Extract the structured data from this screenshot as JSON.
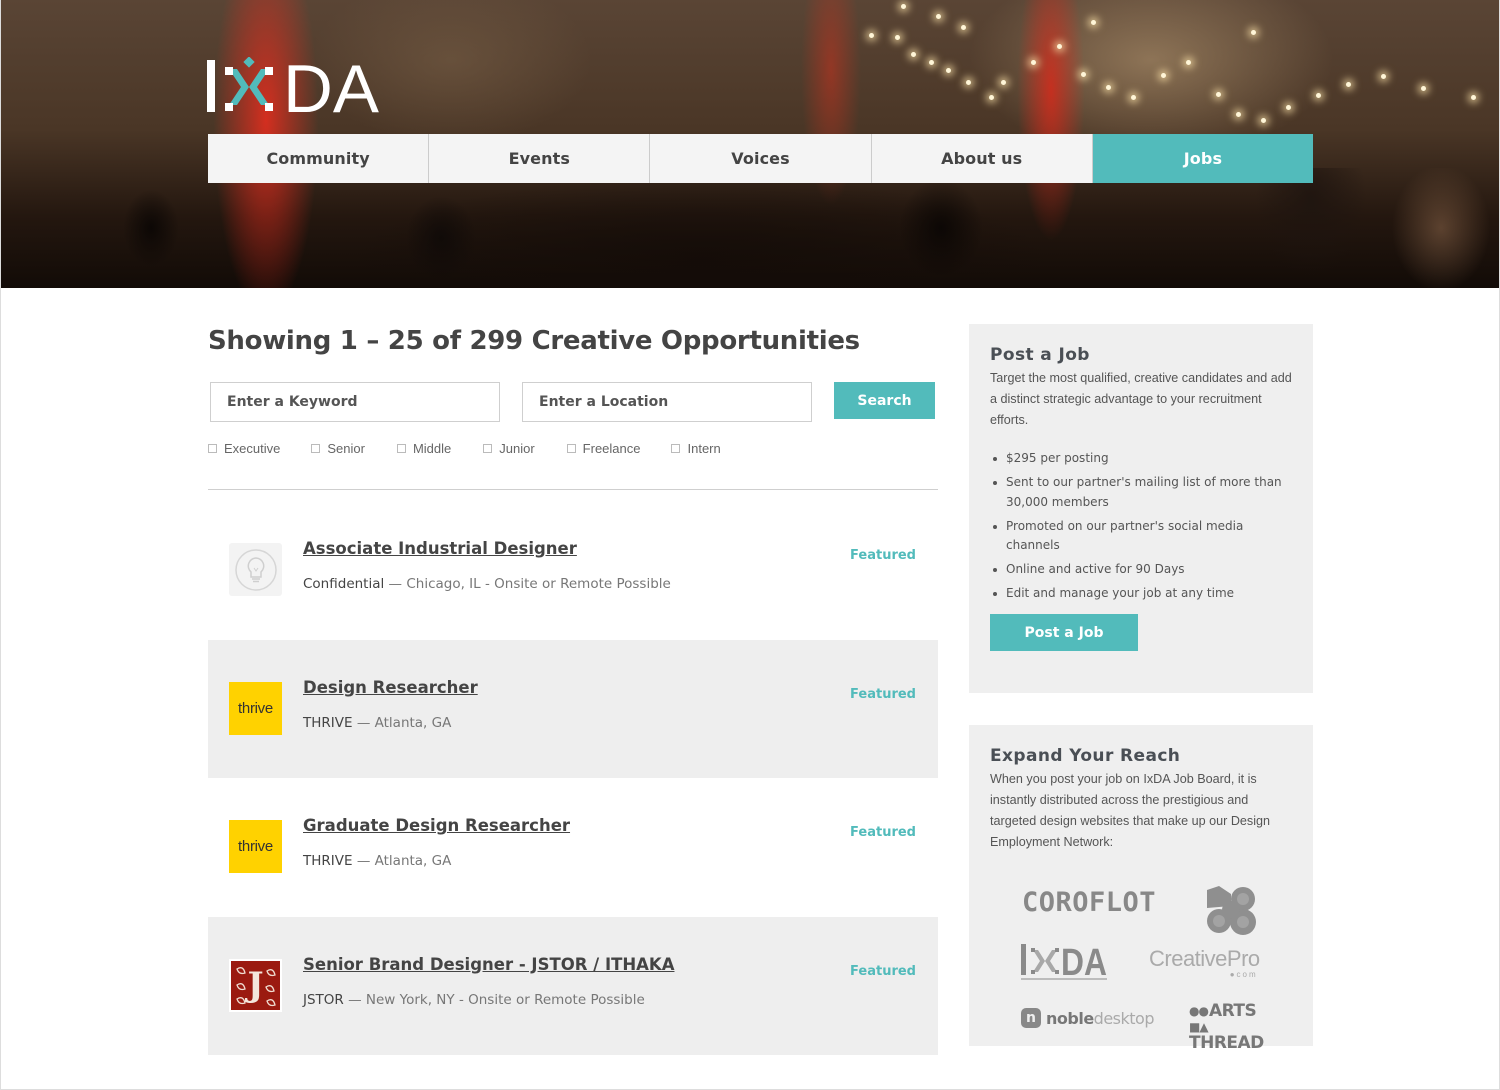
{
  "brand": {
    "logo_text_left": "I",
    "logo_text_right": "DA",
    "logo_name": "IxDA",
    "accent_color": "#52bbbb"
  },
  "nav": {
    "items": [
      {
        "label": "Community",
        "active": false
      },
      {
        "label": "Events",
        "active": false
      },
      {
        "label": "Voices",
        "active": false
      },
      {
        "label": "About us",
        "active": false
      },
      {
        "label": "Jobs",
        "active": true
      }
    ]
  },
  "results": {
    "title": "Showing 1 – 25 of 299 Creative Opportunities",
    "range_start": 1,
    "range_end": 25,
    "total": 299
  },
  "search": {
    "keyword_placeholder": "Enter a Keyword",
    "keyword_value": "",
    "location_placeholder": "Enter a Location",
    "location_value": "",
    "button_label": "Search"
  },
  "filters": [
    {
      "label": "Executive",
      "checked": false
    },
    {
      "label": "Senior",
      "checked": false
    },
    {
      "label": "Middle",
      "checked": false
    },
    {
      "label": "Junior",
      "checked": false
    },
    {
      "label": "Freelance",
      "checked": false
    },
    {
      "label": "Intern",
      "checked": false
    }
  ],
  "jobs": [
    {
      "title": "Associate Industrial Designer",
      "company": "Confidential",
      "separator": " — ",
      "location": "Chicago, IL - Onsite or Remote Possible",
      "badge": "Featured",
      "logo": "lightbulb-icon"
    },
    {
      "title": "Design Researcher",
      "company": "THRIVE",
      "separator": " — ",
      "location": "Atlanta, GA",
      "badge": "Featured",
      "logo": "thrive",
      "logo_text": "thrive"
    },
    {
      "title": "Graduate Design Researcher",
      "company": "THRIVE",
      "separator": " — ",
      "location": "Atlanta, GA",
      "badge": "Featured",
      "logo": "thrive",
      "logo_text": "thrive"
    },
    {
      "title": "Senior Brand Designer - JSTOR / ITHAKA",
      "company": "JSTOR",
      "separator": " — ",
      "location": "New York, NY - Onsite or Remote Possible",
      "badge": "Featured",
      "logo": "jstor",
      "logo_text": "J"
    }
  ],
  "post_job": {
    "title": "Post a Job",
    "description": "Target the most qualified, creative candidates and add a distinct strategic advantage to your recruitment efforts.",
    "perks": [
      "$295 per posting",
      "Sent to our partner's mailing list of more than 30,000 members",
      "Promoted on our partner's social media channels",
      "Online and active for 90 Days",
      "Edit and manage your job at any time"
    ],
    "price": "$295",
    "button_label": "Post a Job"
  },
  "reach": {
    "title": "Expand Your Reach",
    "description": "When you post your job on IxDA Job Board, it is instantly distributed across the prestigious and targeted design websites that make up our Design Employment Network:",
    "partners": [
      {
        "name": "COROFLOT"
      },
      {
        "name": "MOO"
      },
      {
        "name": "IxDA",
        "text_left": "I",
        "text_right": "DA"
      },
      {
        "name": "CreativePro",
        "text": "CreativePro",
        "suffix": "com"
      },
      {
        "name": "noble desktop",
        "glyph": "n",
        "text_bold": "noble",
        "text_light": "desktop"
      },
      {
        "name": "ARTS THREAD",
        "line1": "ARTS",
        "line2": "THREAD"
      }
    ]
  }
}
